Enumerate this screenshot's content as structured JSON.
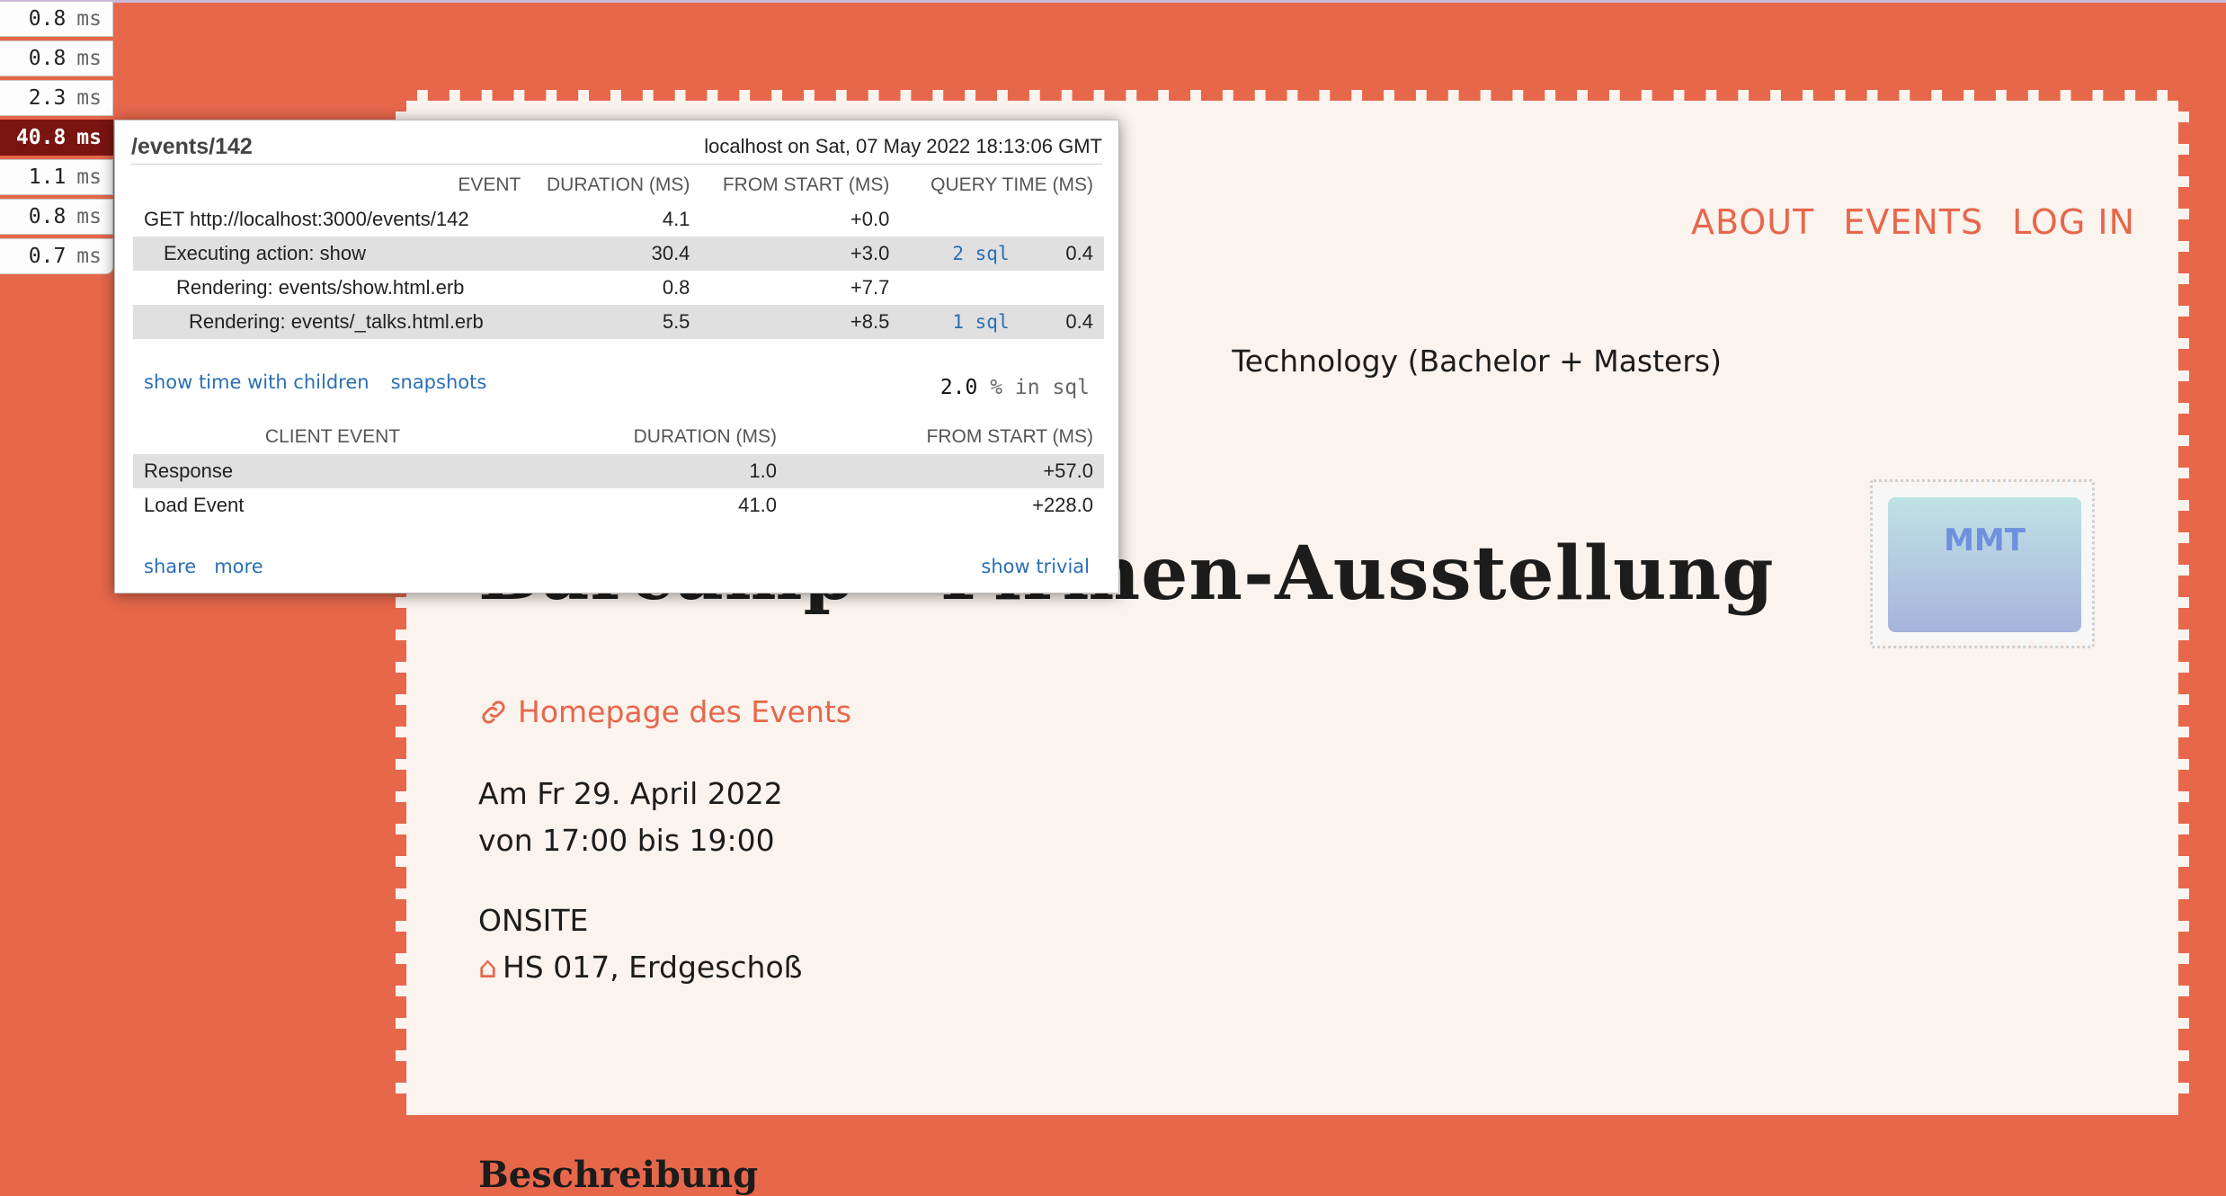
{
  "badges": [
    {
      "value": "0.8",
      "unit": "ms"
    },
    {
      "value": "0.8",
      "unit": "ms"
    },
    {
      "value": "2.3",
      "unit": "ms"
    },
    {
      "value": "40.8",
      "unit": "ms",
      "active": true
    },
    {
      "value": "1.1",
      "unit": "ms"
    },
    {
      "value": "0.8",
      "unit": "ms"
    },
    {
      "value": "0.7",
      "unit": "ms"
    }
  ],
  "profiler": {
    "path": "/events/142",
    "host": "localhost on Sat, 07 May 2022 18:13:06 GMT",
    "headers": {
      "event": "EVENT",
      "duration": "DURATION (MS)",
      "from_start": "FROM START (MS)",
      "query_time": "QUERY TIME (MS)"
    },
    "rows": [
      {
        "event": "GET http://localhost:3000/events/142",
        "duration": "4.1",
        "from_start": "+0.0",
        "sql": "",
        "query": ""
      },
      {
        "event": "Executing action: show",
        "duration": "30.4",
        "from_start": "+3.0",
        "sql": "2 sql",
        "query": "0.4"
      },
      {
        "event": "Rendering: events/show.html.erb",
        "duration": "0.8",
        "from_start": "+7.7",
        "sql": "",
        "query": ""
      },
      {
        "event": "Rendering: events/_talks.html.erb",
        "duration": "5.5",
        "from_start": "+8.5",
        "sql": "1 sql",
        "query": "0.4"
      }
    ],
    "show_children": "show time with children",
    "snapshots": "snapshots",
    "sql_pct_value": "2.0",
    "sql_pct_label": "% in sql",
    "client_headers": {
      "event": "CLIENT EVENT",
      "duration": "DURATION (MS)",
      "from_start": "FROM START (MS)"
    },
    "client_rows": [
      {
        "event": "Response",
        "duration": "1.0",
        "from_start": "+57.0"
      },
      {
        "event": "Load Event",
        "duration": "41.0",
        "from_start": "+228.0"
      }
    ],
    "share": "share",
    "more": "more",
    "show_trivial": "show trivial"
  },
  "page": {
    "nav": [
      "ABOUT",
      "EVENTS",
      "LOG IN"
    ],
    "subtitle": "Technology (Bachelor + Masters)",
    "title": "Barcamp - Firmen-Ausstellung",
    "homepage_link": "Homepage des Events",
    "date_line": "Am Fr 29. April 2022",
    "time_line": "von 17:00 bis 19:00",
    "mode": "ONSITE",
    "room_icon": "⌂",
    "room": "HS 017, Erdgeschoß",
    "section_heading": "Beschreibung",
    "stamp_text": "MMT"
  },
  "colors": {
    "accent": "#e7674b",
    "card": "#fbf3ee",
    "active_badge": "#7a1410",
    "link_blue": "#2a6fb5"
  }
}
